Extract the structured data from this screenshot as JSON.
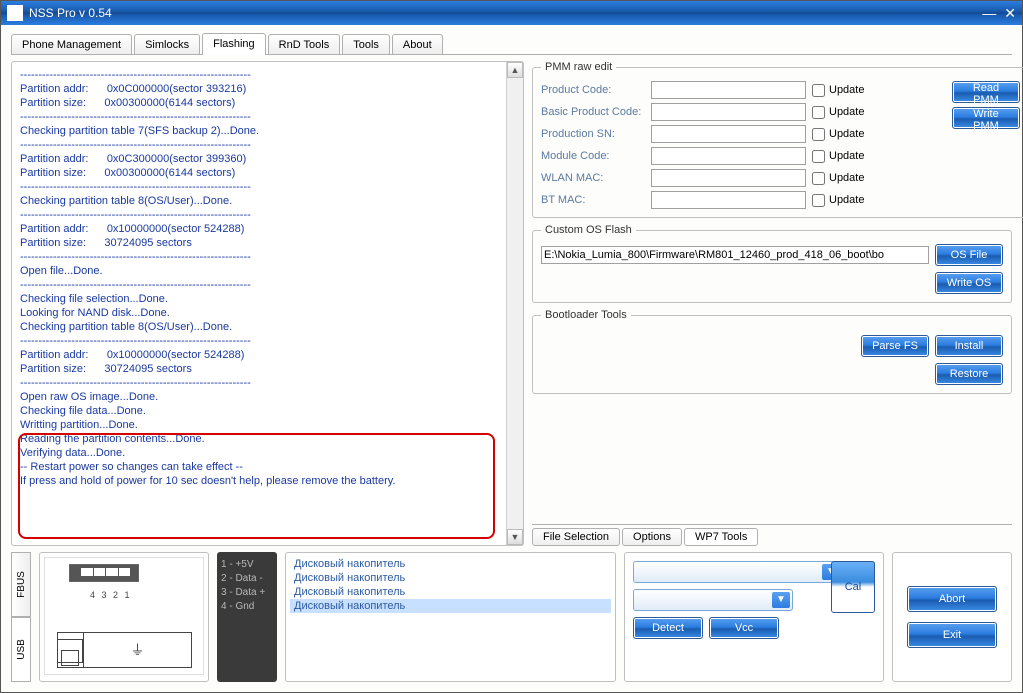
{
  "window": {
    "title": "NSS Pro v 0.54"
  },
  "main_tabs": [
    "Phone Management",
    "Simlocks",
    "Flashing",
    "RnD Tools",
    "Tools",
    "About"
  ],
  "main_tab_active": 2,
  "log_lines": [
    "---------------------------------------------------------------",
    "Partition addr:      0x0C000000(sector 393216)",
    "Partition size:      0x00300000(6144 sectors)",
    "---------------------------------------------------------------",
    "Checking partition table 7(SFS backup 2)...Done.",
    "---------------------------------------------------------------",
    "Partition addr:      0x0C300000(sector 399360)",
    "Partition size:      0x00300000(6144 sectors)",
    "---------------------------------------------------------------",
    "Checking partition table 8(OS/User)...Done.",
    "---------------------------------------------------------------",
    "Partition addr:      0x10000000(sector 524288)",
    "Partition size:      30724095 sectors",
    "---------------------------------------------------------------",
    "Open file...Done.",
    "---------------------------------------------------------------",
    "Checking file selection...Done.",
    "Looking for NAND disk...Done.",
    "Checking partition table 8(OS/User)...Done.",
    "---------------------------------------------------------------",
    "Partition addr:      0x10000000(sector 524288)",
    "Partition size:      30724095 sectors",
    "---------------------------------------------------------------",
    "Open raw OS image...Done.",
    "Checking file data...Done.",
    "Writting partition...Done.",
    "Reading the partition contents...Done.",
    "Verifying data...Done.",
    "-- Restart power so changes can take effect --",
    "If press and hold of power for 10 sec doesn't help, please remove the battery."
  ],
  "pmm": {
    "legend": "PMM raw edit",
    "rows": [
      {
        "label": "Product Code:",
        "update": "Update"
      },
      {
        "label": "Basic Product Code:",
        "update": "Update"
      },
      {
        "label": "Production SN:",
        "update": "Update"
      },
      {
        "label": "Module Code:",
        "update": "Update"
      },
      {
        "label": "WLAN MAC:",
        "update": "Update"
      },
      {
        "label": "BT MAC:",
        "update": "Update"
      }
    ],
    "read_btn": "Read PMM",
    "write_btn": "Write PMM"
  },
  "custom_os": {
    "legend": "Custom OS Flash",
    "path": "E:\\Nokia_Lumia_800\\Firmware\\RM801_12460_prod_418_06_boot\\bo",
    "os_file_btn": "OS File",
    "write_os_btn": "Write OS"
  },
  "bootloader": {
    "legend": "Bootloader Tools",
    "parse_btn": "Parse FS",
    "install_btn": "Install",
    "restore_btn": "Restore"
  },
  "sub_tabs": [
    "File Selection",
    "Options",
    "WP7 Tools"
  ],
  "sub_tab_active": 2,
  "usb_tabs": [
    "FBUS",
    "USB"
  ],
  "usb_tab_active": 1,
  "pin_label": "4 3 2 1",
  "hints": [
    "1 - +5V",
    "2 - Data -",
    "3 - Data +",
    "4 - Gnd"
  ],
  "drives": [
    "Дисковый накопитель",
    "Дисковый накопитель",
    "Дисковый накопитель",
    "Дисковый накопитель"
  ],
  "drive_selected": 3,
  "ctrl": {
    "go_btn": ">",
    "detect_btn": "Detect",
    "vcc_btn": "Vcc",
    "cal_btn": "Cal"
  },
  "exit": {
    "abort_btn": "Abort",
    "exit_btn": "Exit"
  }
}
